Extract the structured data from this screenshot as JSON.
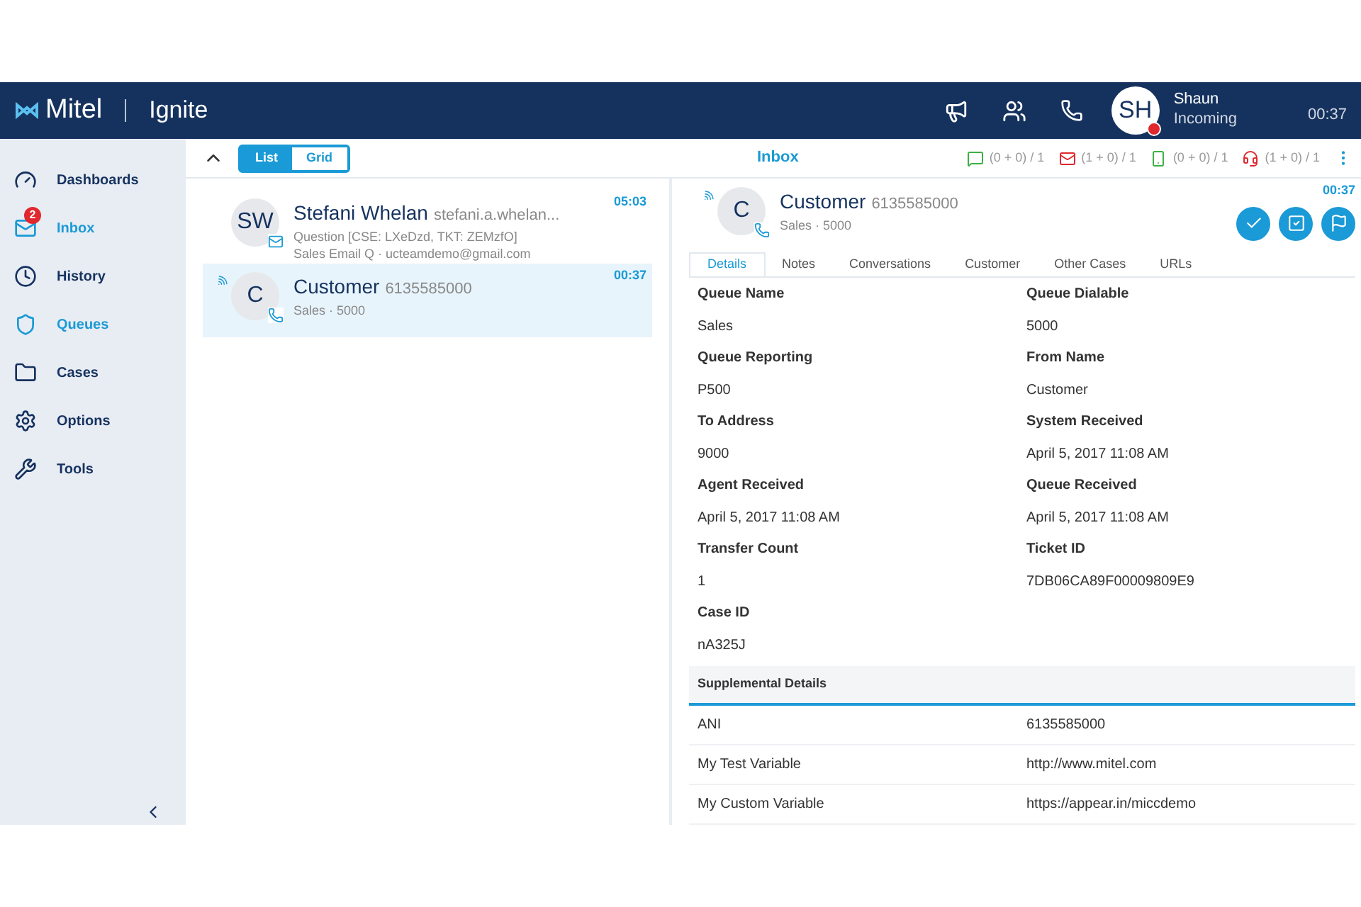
{
  "app": {
    "brand": "Mitel",
    "product": "Ignite"
  },
  "agent": {
    "initials": "SH",
    "name": "Shaun",
    "status": "Incoming",
    "time": "00:37",
    "busy": true
  },
  "sidebar": {
    "items": [
      {
        "kind": "dashboards",
        "label": "Dashboards",
        "selected": false
      },
      {
        "kind": "inbox",
        "label": "Inbox",
        "selected": true,
        "badge": "2"
      },
      {
        "kind": "history",
        "label": "History",
        "selected": false
      },
      {
        "kind": "queues",
        "label": "Queues",
        "selected": true
      },
      {
        "kind": "cases",
        "label": "Cases",
        "selected": false
      },
      {
        "kind": "options",
        "label": "Options",
        "selected": false
      },
      {
        "kind": "tools",
        "label": "Tools",
        "selected": false
      }
    ]
  },
  "view_toggle": [
    {
      "label": "List",
      "selected": true
    },
    {
      "label": "Grid",
      "selected": false
    }
  ],
  "pane_title": "Inbox",
  "counters": [
    {
      "kind": "chat",
      "color": "#3cb043",
      "text": "(0 + 0) / 1"
    },
    {
      "kind": "email",
      "color": "#e0282e",
      "text": "(1 + 0) / 1"
    },
    {
      "kind": "mobile",
      "color": "#3cb043",
      "text": "(0 + 0) / 1"
    },
    {
      "kind": "headset",
      "color": "#e0282e",
      "text": "(1 + 0) / 1"
    }
  ],
  "conversations": [
    {
      "initials": "SW",
      "name": "Stefani Whelan",
      "secondary": "stefani.a.whelan...",
      "lines": [
        "Question [CSE: LXeDzd, TKT: ZEMzfO]",
        "Sales Email Q · ucteamdemo@gmail.com"
      ],
      "time": "05:03",
      "kind": "email",
      "signal": false,
      "selected": false
    },
    {
      "initials": "C",
      "name": "Customer",
      "secondary": "6135585000",
      "lines": [
        "Sales · 5000"
      ],
      "time": "00:37",
      "kind": "phone",
      "signal": true,
      "selected": true
    }
  ],
  "detail": {
    "initials": "C",
    "name": "Customer",
    "number": "6135585000",
    "subtitle": "Sales · 5000",
    "time": "00:37",
    "tabs": [
      {
        "label": "Details",
        "selected": true
      },
      {
        "label": "Notes",
        "selected": false
      },
      {
        "label": "Conversations",
        "selected": false
      },
      {
        "label": "Customer",
        "selected": false
      },
      {
        "label": "Other Cases",
        "selected": false
      },
      {
        "label": "URLs",
        "selected": false
      }
    ],
    "fields": [
      {
        "label": "Queue Name",
        "value": "Sales"
      },
      {
        "label": "Queue Dialable",
        "value": "5000"
      },
      {
        "label": "Queue Reporting",
        "value": "P500"
      },
      {
        "label": "From Name",
        "value": "Customer"
      },
      {
        "label": "To Address",
        "value": "9000"
      },
      {
        "label": "System Received",
        "value": "April 5, 2017 11:08 AM"
      },
      {
        "label": "Agent Received",
        "value": "April 5, 2017 11:08 AM"
      },
      {
        "label": "Queue Received",
        "value": "April 5, 2017 11:08 AM"
      },
      {
        "label": "Transfer Count",
        "value": "1"
      },
      {
        "label": "Ticket ID",
        "value": "7DB06CA89F00009809E9"
      },
      {
        "label": "Case ID",
        "value": "nA325J"
      }
    ],
    "supplemental_title": "Supplemental Details",
    "supplemental": [
      {
        "name": "ANI",
        "value": "6135585000"
      },
      {
        "name": "My Test Variable",
        "value": "http://www.mitel.com"
      },
      {
        "name": "My Custom Variable",
        "value": "https://appear.in/miccdemo"
      }
    ]
  }
}
